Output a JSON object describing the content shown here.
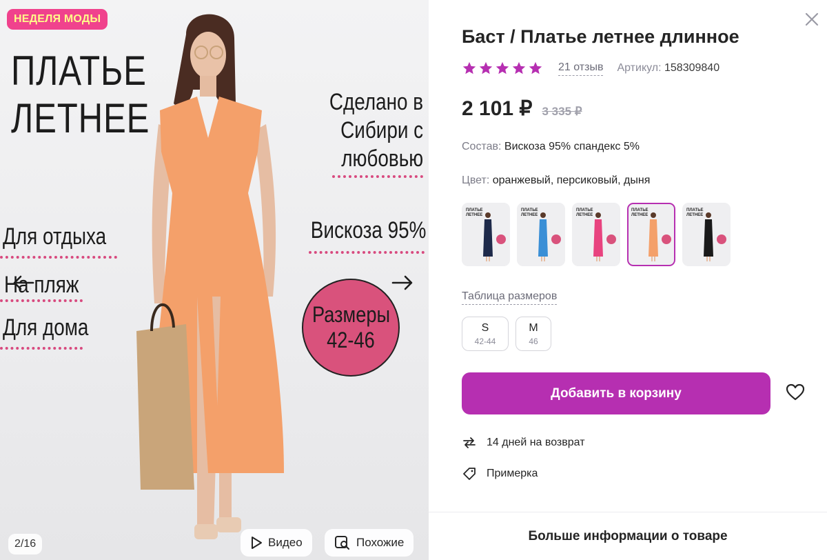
{
  "gallery": {
    "badge": "НЕДЕЛЯ МОДЫ",
    "overlay_title_line1": "ПЛАТЬЕ",
    "overlay_title_line2": "ЛЕТНЕЕ",
    "made_in_line1": "Сделано в",
    "made_in_line2": "Сибири с",
    "made_in_line3": "любовью",
    "material": "Вискоза 95%",
    "use_1": "Для отдыха",
    "use_2": "На пляж",
    "use_3": "Для дома",
    "sizes_line1": "Размеры",
    "sizes_line2": "42-46",
    "counter": "2/16",
    "video_label": "Видео",
    "similar_label": "Похожие",
    "dress_color": "#f4a06a"
  },
  "product": {
    "title": "Баст / Платье летнее длинное",
    "rating_stars": 5,
    "reviews": "21 отзыв",
    "article_label": "Артикул:",
    "article_value": "158309840",
    "price_now": "2 101 ₽",
    "price_old": "3 335 ₽",
    "composition_label": "Состав:",
    "composition_value": "Вискоза 95% спандекс 5%",
    "color_label": "Цвет:",
    "color_value": "оранжевый, персиковый, дыня",
    "thumbs": [
      {
        "color": "#1e2a4a",
        "active": false
      },
      {
        "color": "#3a8fd6",
        "active": false
      },
      {
        "color": "#e8437f",
        "active": false
      },
      {
        "color": "#f4a06a",
        "active": true
      },
      {
        "color": "#1a1a1a",
        "active": false
      }
    ],
    "size_table_link": "Таблица размеров",
    "sizes": [
      {
        "label": "S",
        "range": "42-44"
      },
      {
        "label": "M",
        "range": "46"
      }
    ],
    "add_to_cart": "Добавить в корзину",
    "return_text": "14 дней на возврат",
    "fitting_text": "Примерка",
    "more_info": "Больше информации о товаре",
    "accent_color": "#b62fb1",
    "star_color": "#b62fb1"
  }
}
